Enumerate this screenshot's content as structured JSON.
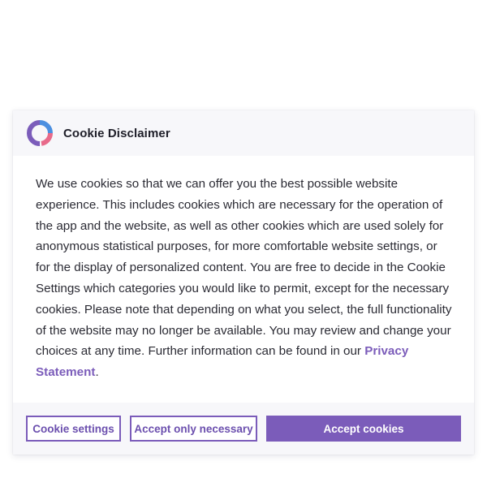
{
  "dialog": {
    "title": "Cookie Disclaimer",
    "logo_icon": "brand-ring-logo",
    "body_text": "We use cookies so that we can offer you the best possible website experience. This includes cookies which are necessary for the operation of the app and the website, as well as other cookies which are used solely for anonymous statistical purposes, for more comfortable website settings, or for the display of personalized content. You are free to decide in the Cookie Settings which categories you would like to permit, except for the necessary cookies. Please note that depending on what you select, the full functionality of the website may no longer be available. You may review and change your choices at any time. Further information can be found in our ",
    "privacy_link_text": "Privacy Statement",
    "body_end": "."
  },
  "buttons": {
    "cookie_settings": "Cookie settings",
    "accept_necessary": "Accept only necessary",
    "accept_cookies": "Accept cookies"
  },
  "colors": {
    "accent": "#7b5cba",
    "logo_purple": "#7b5cba",
    "logo_blue": "#4b8fe0",
    "logo_pink": "#e86a8a",
    "header_bg": "#f7f7fa"
  }
}
